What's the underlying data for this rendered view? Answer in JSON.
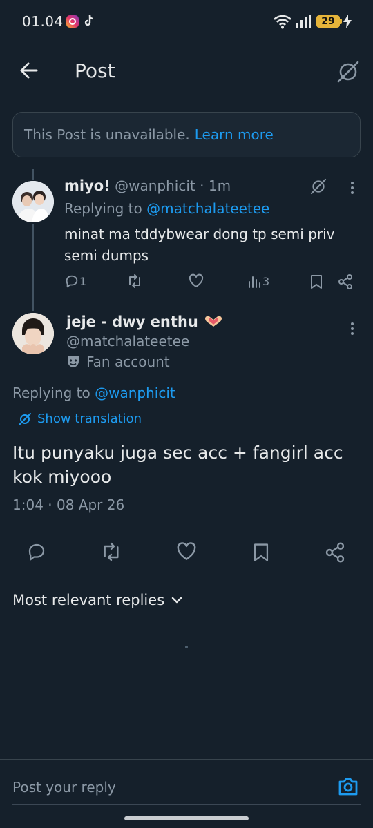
{
  "status_bar": {
    "time": "01.04",
    "battery": "29",
    "icons": [
      "instagram-icon",
      "tiktok-icon",
      "wifi-icon",
      "signal-icon",
      "battery-icon",
      "charging-icon"
    ]
  },
  "header": {
    "title": "Post",
    "icons": [
      "back-arrow-icon",
      "translate-globe-icon"
    ]
  },
  "notice": {
    "text": "This Post is unavailable.",
    "link": "Learn more"
  },
  "parent_reply": {
    "display_name": "miyo!",
    "handle": "@wanphicit",
    "time": "· 1m",
    "replying_label": "Replying to",
    "replying_handle": "@matchalateetee",
    "text": "minat ma tddybwear dong tp semi priv semi dumps",
    "reply_count": "1",
    "views_count": "3"
  },
  "main_post": {
    "display_name": "jeje - dwy enthu",
    "name_emoji": "heart-hands-emoji",
    "handle": "@matchalateetee",
    "account_label": "Fan account",
    "replying_label": "Replying to",
    "replying_handle": "@wanphicit",
    "translate_label": "Show translation",
    "text": "Itu punyaku juga sec acc + fangirl acc kok miyooo",
    "timestamp": "1:04 · 08 Apr 26"
  },
  "replies_sort": {
    "label": "Most relevant replies"
  },
  "composer": {
    "placeholder": "Post your reply"
  },
  "colors": {
    "background": "#15202b",
    "accent": "#1d9bf0",
    "muted": "#8b98a5",
    "divider": "#38444d"
  }
}
